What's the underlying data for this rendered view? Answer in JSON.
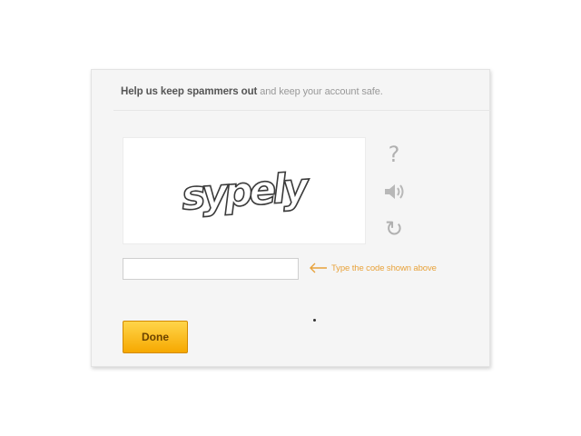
{
  "header": {
    "title_bold": "Help us keep spammers out",
    "title_rest": " and keep your account safe."
  },
  "captcha": {
    "word": "sypely"
  },
  "controls": {
    "help_icon": "question-mark",
    "audio_icon": "speaker",
    "refresh_icon": "refresh-arrow"
  },
  "input": {
    "value": "",
    "placeholder": ""
  },
  "hint": {
    "text": "Type the code shown above",
    "color": "#e8a23a"
  },
  "button": {
    "done_label": "Done",
    "color": "#f6b800"
  }
}
